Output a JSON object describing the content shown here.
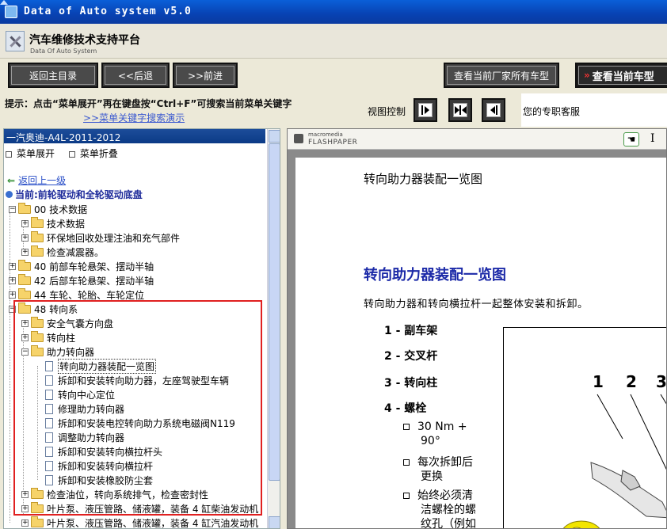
{
  "window": {
    "title": "Data of Auto system v5.0"
  },
  "header": {
    "app_name_cn": "汽车维修技术支持平台",
    "app_name_en": "Data Of Auto System"
  },
  "nav": {
    "home": "返回主目录",
    "back": "<<后退",
    "forward": ">>前进",
    "all_models": "查看当前厂家所有车型",
    "current_model": "查看当前车型"
  },
  "hint": {
    "text": "提示：点击“菜单展开”再在键盘按“Ctrl+F”可搜索当前菜单关键字",
    "demo_link": ">>菜单关键字搜索演示",
    "view_control": "视图控制",
    "service": "您的专职客服"
  },
  "sidebar": {
    "car": "一汽奥迪-A4L-2011-2012",
    "expand": "菜单展开",
    "collapse": "菜单折叠",
    "back_up": "返回上一级",
    "current": "当前:前轮驱动和全轮驱动底盘",
    "tree": [
      {
        "label": "00 技术数据",
        "pm": "−",
        "type": "folder"
      },
      {
        "label": "技术数据",
        "pm": "+",
        "type": "folder"
      },
      {
        "label": "环保地回收处理注油和充气部件",
        "pm": "+",
        "type": "folder"
      },
      {
        "label": "检查减震器。",
        "pm": "+",
        "type": "folder"
      },
      {
        "label": "40 前部车轮悬架、摆动半轴",
        "pm": "+",
        "type": "folder"
      },
      {
        "label": "42 后部车轮悬架、摆动半轴",
        "pm": "+",
        "type": "folder"
      },
      {
        "label": "44 车轮、轮胎、车轮定位",
        "pm": "+",
        "type": "folder"
      },
      {
        "label": "48 转向系",
        "pm": "−",
        "type": "folder"
      },
      {
        "label": "安全气囊方向盘",
        "pm": "+",
        "type": "folder"
      },
      {
        "label": "转向柱",
        "pm": "+",
        "type": "folder"
      },
      {
        "label": "助力转向器",
        "pm": "−",
        "type": "folder"
      },
      {
        "label": "转向助力器装配一览图",
        "type": "doc"
      },
      {
        "label": "拆卸和安装转向助力器，左座驾驶型车辆",
        "type": "doc"
      },
      {
        "label": "转向中心定位",
        "type": "doc"
      },
      {
        "label": "修理助力转向器",
        "type": "doc"
      },
      {
        "label": "拆卸和安装电控转向助力系统电磁阀N119",
        "type": "doc"
      },
      {
        "label": "调整助力转向器",
        "type": "doc"
      },
      {
        "label": "拆卸和安装转向横拉杆头",
        "type": "doc"
      },
      {
        "label": "拆卸和安装转向横拉杆",
        "type": "doc"
      },
      {
        "label": "拆卸和安装橡胶防尘套",
        "type": "doc"
      },
      {
        "label": "检查油位，转向系统排气，检查密封性",
        "pm": "+",
        "type": "folder"
      },
      {
        "label": "叶片泵、液压管路、储液罐，装备 4 缸柴油发动机",
        "pm": "+",
        "type": "folder"
      },
      {
        "label": "叶片泵、液压管路、储液罐，装备 4 缸汽油发动机",
        "pm": "+",
        "type": "folder"
      }
    ]
  },
  "viewer": {
    "brand_small": "macromedia",
    "brand": "FLASHPAPER",
    "page_header": "转向助力器装配一览图",
    "heading": "转向助力器装配一览图",
    "intro": "转向助力器和转向横拉杆一起整体安装和拆卸。",
    "items": [
      "1 - 副车架",
      "2 - 交叉杆",
      "3 - 转向柱",
      "4 - 螺栓"
    ],
    "bullets": [
      "30 Nm +",
      "90°",
      "每次拆卸后",
      "更换",
      "始终必须清",
      "洁螺栓的螺",
      "纹孔（例如"
    ],
    "figure_numbers": [
      "1",
      "2",
      "3"
    ]
  }
}
